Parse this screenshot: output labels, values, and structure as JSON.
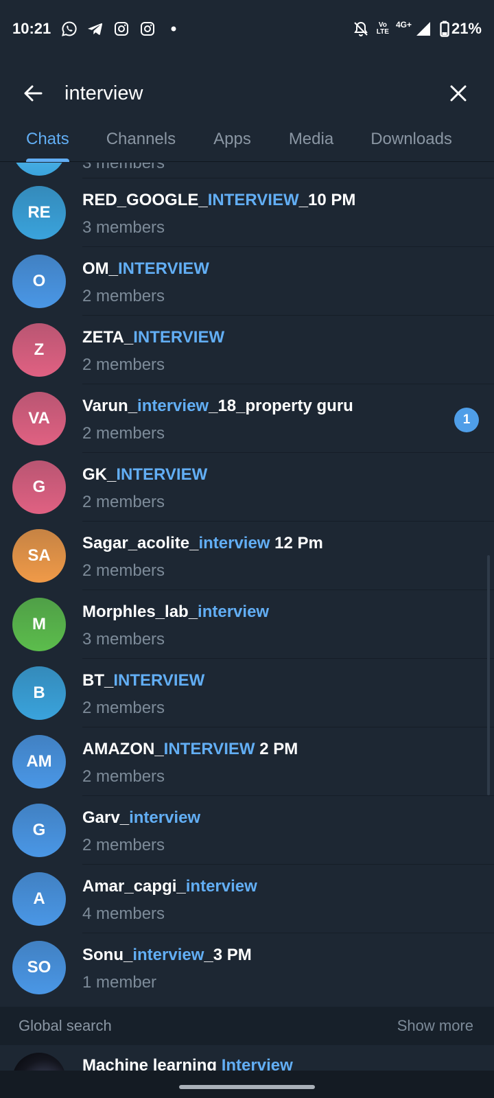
{
  "status_bar": {
    "time": "10:21",
    "app_icons": [
      "whatsapp-icon",
      "telegram-icon",
      "instagram-icon",
      "instagram-icon"
    ],
    "volte_label_top": "Vo",
    "volte_label_bottom": "LTE",
    "network": "4G+",
    "battery": "21%"
  },
  "search": {
    "query": "interview"
  },
  "tabs": [
    {
      "label": "Chats",
      "active": true
    },
    {
      "label": "Channels",
      "active": false
    },
    {
      "label": "Apps",
      "active": false
    },
    {
      "label": "Media",
      "active": false
    },
    {
      "label": "Downloads",
      "active": false
    }
  ],
  "partial_row": {
    "subtitle": "3 members"
  },
  "chats": [
    {
      "initials": "RE",
      "color": "#3aa3dc",
      "title_pre": "RED_GOOGLE_",
      "title_hl": "INTERVIEW",
      "title_post": "_10 PM",
      "subtitle": "3 members",
      "unread": ""
    },
    {
      "initials": "O",
      "color": "#4a97e6",
      "title_pre": "OM_",
      "title_hl": "INTERVIEW",
      "title_post": "",
      "subtitle": "2 members",
      "unread": ""
    },
    {
      "initials": "Z",
      "color": "#e06182",
      "title_pre": "ZETA_",
      "title_hl": "INTERVIEW",
      "title_post": "",
      "subtitle": "2 members",
      "unread": ""
    },
    {
      "initials": "VA",
      "color": "#e06182",
      "title_pre": "Varun_",
      "title_hl": "interview",
      "title_post": "_18_property guru",
      "subtitle": "2 members",
      "unread": "1"
    },
    {
      "initials": "G",
      "color": "#e06182",
      "title_pre": "GK_",
      "title_hl": "INTERVIEW",
      "title_post": "",
      "subtitle": "2 members",
      "unread": ""
    },
    {
      "initials": "SA",
      "color": "#f09a48",
      "title_pre": "Sagar_acolite_",
      "title_hl": "interview",
      "title_post": " 12 Pm",
      "subtitle": "2 members",
      "unread": ""
    },
    {
      "initials": "M",
      "color": "#5cbd4c",
      "title_pre": "Morphles_lab_",
      "title_hl": "interview",
      "title_post": "",
      "subtitle": "3 members",
      "unread": ""
    },
    {
      "initials": "B",
      "color": "#3aa3dc",
      "title_pre": "BT_",
      "title_hl": "INTERVIEW",
      "title_post": "",
      "subtitle": "2 members",
      "unread": ""
    },
    {
      "initials": "AM",
      "color": "#4a97e6",
      "title_pre": "AMAZON_",
      "title_hl": "INTERVIEW",
      "title_post": " 2 PM",
      "subtitle": "2 members",
      "unread": ""
    },
    {
      "initials": "G",
      "color": "#4a97e6",
      "title_pre": "Garv_",
      "title_hl": "interview",
      "title_post": "",
      "subtitle": "2 members",
      "unread": ""
    },
    {
      "initials": "A",
      "color": "#4a97e6",
      "title_pre": "Amar_capgi_",
      "title_hl": "interview",
      "title_post": "",
      "subtitle": "4 members",
      "unread": ""
    },
    {
      "initials": "SO",
      "color": "#4a97e6",
      "title_pre": "Sonu_",
      "title_hl": "interview",
      "title_post": "_3 PM",
      "subtitle": "1 member",
      "unread": ""
    }
  ],
  "global_search": {
    "header": "Global search",
    "show_more": "Show more",
    "first_result": {
      "title_pre": "Machine learning ",
      "title_hl": "Interview",
      "title_post": ""
    }
  },
  "colors": {
    "background": "#1d2733",
    "accent": "#62aef4",
    "subtitle": "#7d8b99"
  }
}
